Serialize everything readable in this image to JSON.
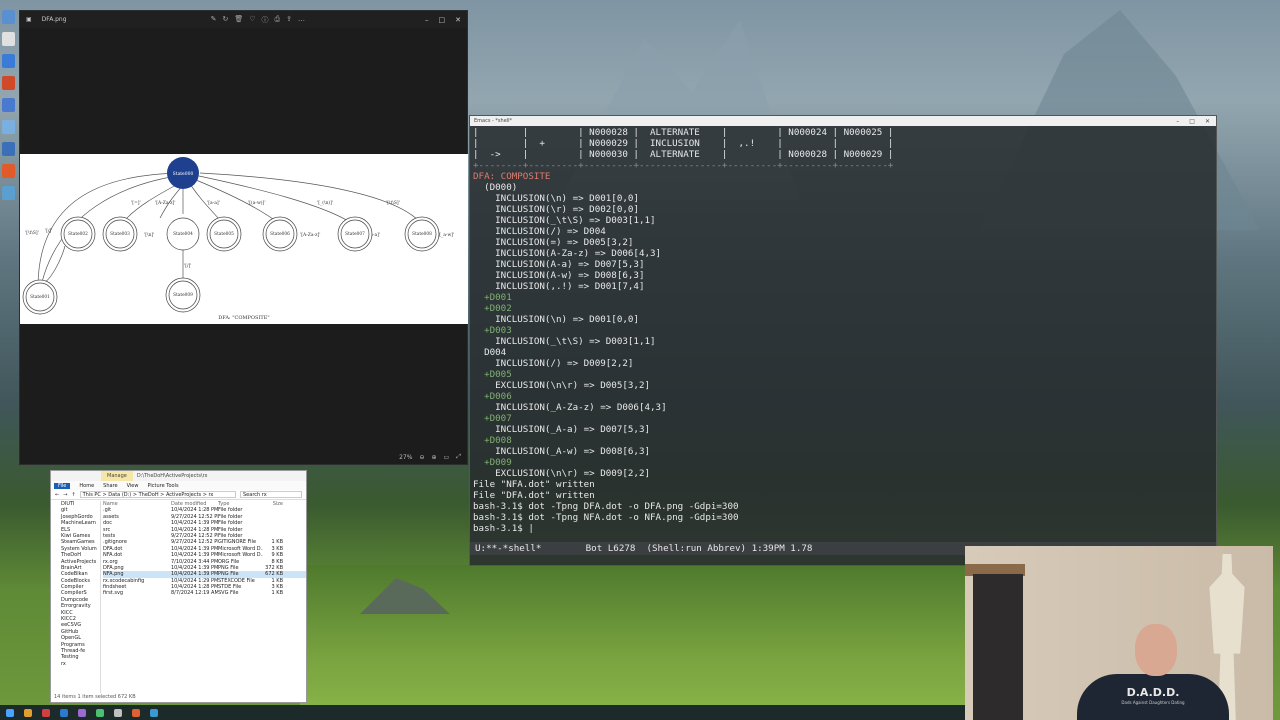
{
  "photo_viewer": {
    "title": "DFA.png",
    "zoom": "27%",
    "diagram": {
      "start_state": "State000",
      "states": [
        "State001",
        "State002",
        "State003",
        "State004",
        "State005",
        "State006",
        "State007",
        "State008",
        "State009"
      ],
      "edge_labels": [
        "'[\\t\\S]'",
        "'[/]'",
        "'[=]'",
        "'[A-Za-z]'",
        "'[a-a]'",
        "'[(a-w)]'",
        "'[_(\\n)]'",
        "'[\\t\\S]'",
        "'[A-Za-z]'",
        "'[_a-a]'",
        "'[_a-w]'",
        "'[\\n]'",
        "'[/]'"
      ],
      "caption": "DFA: \"COMPOSITE\""
    }
  },
  "explorer": {
    "manage_tab": "Manage",
    "title_path": "D:\\TheDoH\\ActiveProjects\\rx",
    "ribbon": [
      "File",
      "Home",
      "Share",
      "View",
      "Picture Tools"
    ],
    "address": "This PC > Data (D:) > TheDoH > ActiveProjects > rx",
    "search": "Search rx",
    "nav": [
      "DIUTI",
      "git",
      "JosephGordo",
      "MachineLearn",
      "ELS",
      "Kiwi Games",
      "SteamGames",
      "System Volum",
      "TheDoH",
      "ActiveProjects",
      "BrainArt",
      "CodeBlkan",
      "CodeBlocks",
      "Compiler",
      "CompilerS",
      "Dumpcode",
      "Errorgravity",
      "KICC",
      "KICC2",
      "eeCSVG",
      "GitHub",
      "OpenGL",
      "Programs",
      "Thread-fe",
      "Testing",
      "rx"
    ],
    "columns": [
      "Name",
      "Date modified",
      "Type",
      "Size"
    ],
    "files": [
      {
        "name": ".git",
        "date": "10/4/2024 1:28 PM",
        "type": "File folder",
        "size": ""
      },
      {
        "name": "assets",
        "date": "9/27/2024 12:52 PM",
        "type": "File folder",
        "size": ""
      },
      {
        "name": "doc",
        "date": "10/4/2024 1:39 PM",
        "type": "File folder",
        "size": ""
      },
      {
        "name": "src",
        "date": "10/4/2024 1:28 PM",
        "type": "File folder",
        "size": ""
      },
      {
        "name": "tests",
        "date": "9/27/2024 12:52 PM",
        "type": "File folder",
        "size": ""
      },
      {
        "name": ".gitignore",
        "date": "9/27/2024 12:52 PM",
        "type": "GITIGNORE File",
        "size": "1 KB"
      },
      {
        "name": "DFA.dot",
        "date": "10/4/2024 1:39 PM",
        "type": "Microsoft Word D...",
        "size": "3 KB"
      },
      {
        "name": "NFA.dot",
        "date": "10/4/2024 1:39 PM",
        "type": "Microsoft Word D...",
        "size": "9 KB"
      },
      {
        "name": "rx.org",
        "date": "7/10/2024 3:44 PM",
        "type": "ORG File",
        "size": "8 KB"
      },
      {
        "name": "DFA.png",
        "date": "10/4/2024 1:39 PM",
        "type": "PNG File",
        "size": "372 KB"
      },
      {
        "name": "NFA.png",
        "date": "10/4/2024 1:39 PM",
        "type": "PNG File",
        "size": "672 KB"
      },
      {
        "name": "rx.xcodecabinfig",
        "date": "10/4/2024 1:29 PM",
        "type": "STEXCODE File",
        "size": "1 KB"
      },
      {
        "name": "findsheet",
        "date": "10/4/2024 1:28 PM",
        "type": "STDE File",
        "size": "3 KB"
      },
      {
        "name": "first.svg",
        "date": "8/7/2024 12:19 AM",
        "type": "SVG File",
        "size": "1 KB"
      }
    ],
    "status": "14 items    1 item selected 672 KB"
  },
  "emacs": {
    "title": "Emacs - *shell*",
    "lines": [
      {
        "text": "|        |         | N000028 |  ALTERNATE    |         | N000024 | N000025 |",
        "style": "wht"
      },
      {
        "text": "|        |  +      | N000029 |  INCLUSION    |  ,.!    |         |         |",
        "style": "wht"
      },
      {
        "text": "|  ->    |         | N000030 |  ALTERNATE    |         | N000028 | N000029 |",
        "style": "wht"
      },
      {
        "text": "+--------+---------+---------+---------------+---------+---------+---------+",
        "style": "dim"
      },
      {
        "text": "DFA: COMPOSITE",
        "style": "red"
      },
      {
        "text": "  (D000)",
        "style": "wht"
      },
      {
        "text": "    INCLUSION(\\n) => D001[0,0]",
        "style": "wht"
      },
      {
        "text": "    INCLUSION(\\r) => D002[0,0]",
        "style": "wht"
      },
      {
        "text": "    INCLUSION(_\\t\\S) => D003[1,1]",
        "style": "wht"
      },
      {
        "text": "    INCLUSION(/) => D004",
        "style": "wht"
      },
      {
        "text": "    INCLUSION(=) => D005[3,2]",
        "style": "wht"
      },
      {
        "text": "    INCLUSION(A-Za-z) => D006[4,3]",
        "style": "wht"
      },
      {
        "text": "    INCLUSION(A-a) => D007[5,3]",
        "style": "wht"
      },
      {
        "text": "    INCLUSION(A-w) => D008[6,3]",
        "style": "wht"
      },
      {
        "text": "    INCLUSION(,.!) => D001[7,4]",
        "style": "wht"
      },
      {
        "text": "  +D001",
        "style": "grn"
      },
      {
        "text": "  +D002",
        "style": "grn"
      },
      {
        "text": "    INCLUSION(\\n) => D001[0,0]",
        "style": "wht"
      },
      {
        "text": "  +D003",
        "style": "grn"
      },
      {
        "text": "    INCLUSION(_\\t\\S) => D003[1,1]",
        "style": "wht"
      },
      {
        "text": "  D004",
        "style": "wht"
      },
      {
        "text": "    INCLUSION(/) => D009[2,2]",
        "style": "wht"
      },
      {
        "text": "  +D005",
        "style": "grn"
      },
      {
        "text": "    EXCLUSION(\\n\\r) => D005[3,2]",
        "style": "wht"
      },
      {
        "text": "  +D006",
        "style": "grn"
      },
      {
        "text": "    INCLUSION(_A-Za-z) => D006[4,3]",
        "style": "wht"
      },
      {
        "text": "  +D007",
        "style": "grn"
      },
      {
        "text": "    INCLUSION(_A-a) => D007[5,3]",
        "style": "wht"
      },
      {
        "text": "  +D008",
        "style": "grn"
      },
      {
        "text": "    INCLUSION(_A-w) => D008[6,3]",
        "style": "wht"
      },
      {
        "text": "  +D009",
        "style": "grn"
      },
      {
        "text": "    EXCLUSION(\\n\\r) => D009[2,2]",
        "style": "wht"
      },
      {
        "text": "File \"NFA.dot\" written",
        "style": "wht"
      },
      {
        "text": "File \"DFA.dot\" written",
        "style": "wht"
      },
      {
        "text": "bash-3.1$ dot -Tpng DFA.dot -o DFA.png -Gdpi=300",
        "style": "wht"
      },
      {
        "text": "bash-3.1$ dot -Tpng NFA.dot -o NFA.png -Gdpi=300",
        "style": "wht"
      },
      {
        "text": "bash-3.1$ |",
        "style": "wht"
      }
    ],
    "mode_line": "U:**-*shell*        Bot L6278  (Shell:run Abbrev) 1:39PM 1.78"
  },
  "webcam": {
    "shirt_text": "D.A.D.D.",
    "shirt_subtext": "Dads Against Daughters Dating"
  }
}
